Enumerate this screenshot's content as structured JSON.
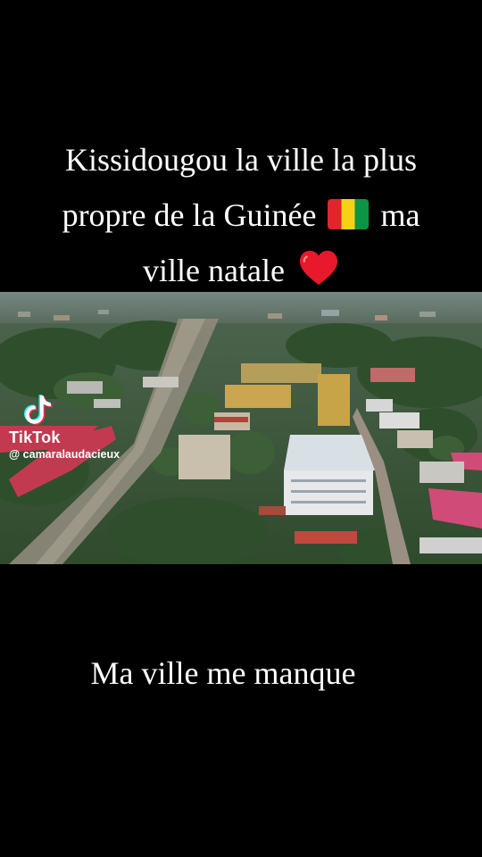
{
  "caption": {
    "line1": "Kissidougou la ville la plus",
    "line2_text": "propre de la Guinée",
    "line2_after": "ma",
    "line3_text": "ville natale",
    "flag_icon": "guinea-flag-icon",
    "heart_icon": "red-heart-icon",
    "flag_colors": [
      "#e3242b",
      "#f7d116",
      "#0d9445"
    ],
    "heart_color": "#e8192c"
  },
  "watermark": {
    "brand": "TikTok",
    "username": "@ camaralaudacieux",
    "logo_icon": "tiktok-logo-icon"
  },
  "subtitle": "Ma ville me manque"
}
